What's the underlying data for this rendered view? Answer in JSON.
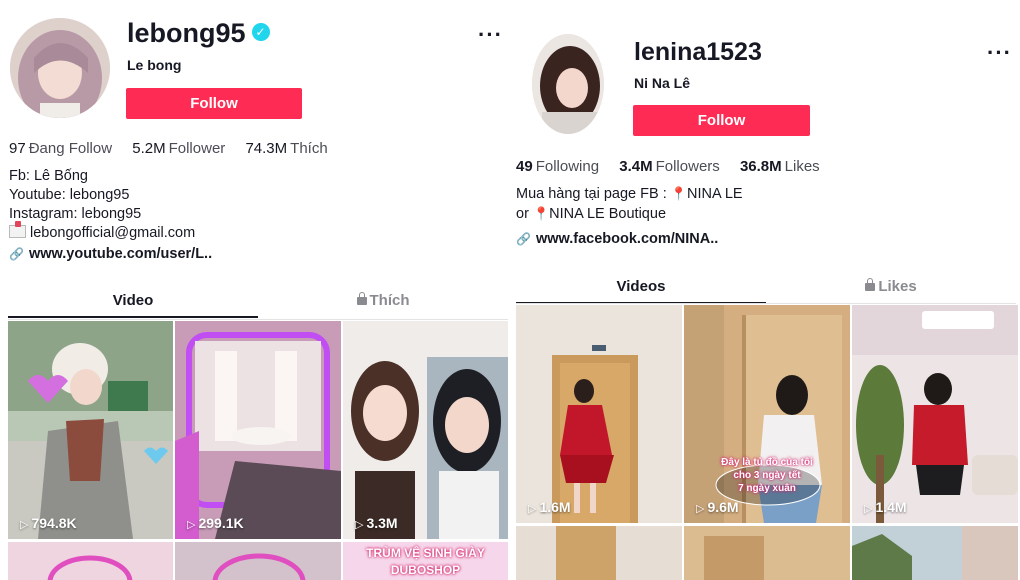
{
  "left": {
    "username": "lebong95",
    "nickname": "Le bong",
    "verified_icon": "✓",
    "more": "···",
    "follow_label": "Follow",
    "stats": [
      {
        "value": "97",
        "label": "Đang Follow"
      },
      {
        "value": "5.2M",
        "label": "Follower"
      },
      {
        "value": "74.3M",
        "label": "Thích"
      }
    ],
    "bio": [
      "Fb: Lê Bống",
      "Youtube: lebong95",
      "Instagram: lebong95",
      "lebongofficial@gmail.com"
    ],
    "link": "www.youtube.com/user/L..",
    "tabs": [
      {
        "label": "Video"
      },
      {
        "label": "Thích"
      }
    ],
    "videos": [
      {
        "views": "794.8K"
      },
      {
        "views": "299.1K"
      },
      {
        "views": "3.3M"
      }
    ],
    "bottom_caption_1": "TRÙM VỆ SINH GIÀY",
    "bottom_caption_2": "DUBOSHOP"
  },
  "right": {
    "username": "lenina1523",
    "nickname": "Ni Na Lê",
    "more": "···",
    "follow_label": "Follow",
    "stats": [
      {
        "value": "49",
        "label": "Following"
      },
      {
        "value": "3.4M",
        "label": "Followers"
      },
      {
        "value": "36.8M",
        "label": "Likes"
      }
    ],
    "bio_line1": "Mua hàng tại page FB :",
    "bio_line1_end": "NINA LE",
    "bio_line2_start": "or",
    "bio_line2_end": "NINA LE Boutique",
    "link": "www.facebook.com/NINA..",
    "tabs": [
      {
        "label": "Videos"
      },
      {
        "label": "Likes"
      }
    ],
    "videos": [
      {
        "views": "1.6M"
      },
      {
        "views": "9.6M"
      },
      {
        "views": "1.4M"
      }
    ],
    "video2_caption_1": "Đây là tủ đồ của tôi",
    "video2_caption_2": "cho 3 ngày tết",
    "video2_caption_3": "7 ngày xuân"
  },
  "colors": {
    "follow": "#fe2c55",
    "verified": "#20d5ec",
    "text": "#161823",
    "muted": "#8a8b91"
  },
  "icons": [
    "verified-icon",
    "more-icon",
    "mail-icon",
    "link-icon",
    "lock-icon",
    "play-icon",
    "pin-icon"
  ]
}
